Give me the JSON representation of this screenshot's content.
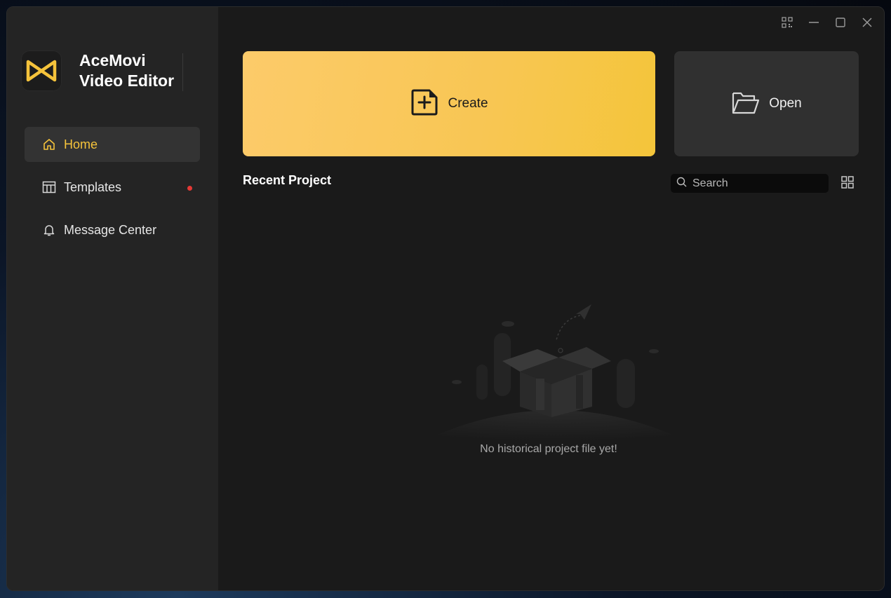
{
  "app": {
    "brand_line1": "AceMovi",
    "brand_line2": "Video Editor",
    "accent_color": "#f5c33b"
  },
  "sidebar": {
    "items": [
      {
        "label": "Home",
        "icon": "home-icon",
        "active": true
      },
      {
        "label": "Templates",
        "icon": "templates-icon",
        "badge": "red-dot"
      },
      {
        "label": "Message Center",
        "icon": "bell-icon"
      }
    ]
  },
  "window_controls": [
    "qr-code-icon",
    "minimize-icon",
    "maximize-icon",
    "close-icon"
  ],
  "actions": {
    "create_label": "Create",
    "open_label": "Open"
  },
  "recent": {
    "title": "Recent Project",
    "search_placeholder": "Search",
    "empty_message": "No historical project file yet!"
  }
}
